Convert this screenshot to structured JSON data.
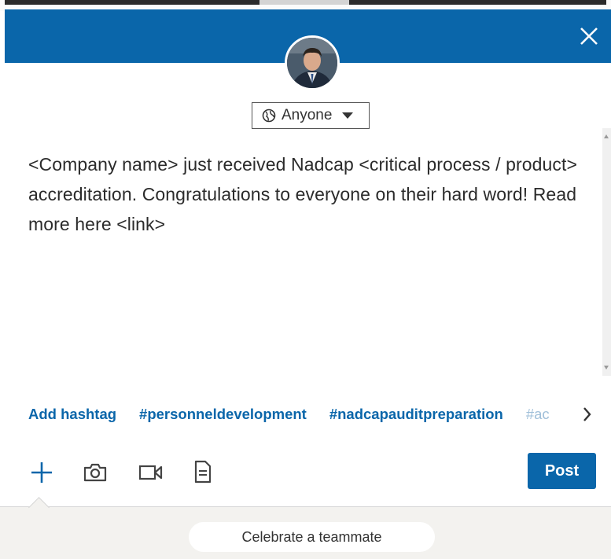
{
  "modal": {
    "close_icon": "close-icon"
  },
  "visibility": {
    "label": "Anyone",
    "icon": "globe-icon"
  },
  "editor": {
    "text": "<Company name> just received Nadcap <critical process / product> accreditation. Congratulations to everyone on their hard word! Read more here <link>"
  },
  "hashtags": {
    "add_label": "Add hashtag",
    "items": [
      "#personneldevelopment",
      "#nadcapauditpreparation",
      "#ac"
    ]
  },
  "toolbar": {
    "icons": [
      "plus-icon",
      "camera-icon",
      "video-icon",
      "document-icon"
    ],
    "post_label": "Post"
  },
  "footer": {
    "celebrate_label": "Celebrate a teammate"
  },
  "colors": {
    "brand": "#0a66aa",
    "footer_bg": "#f3f2ef"
  }
}
